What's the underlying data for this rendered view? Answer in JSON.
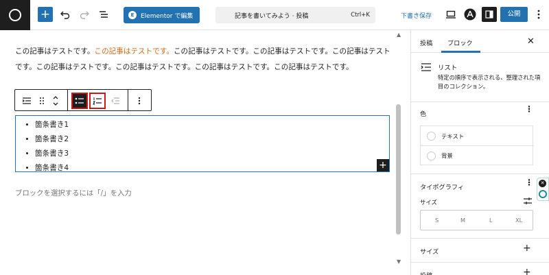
{
  "topbar": {
    "elementor_button": "Elementor で編集",
    "elementor_badge": "E",
    "document_title": "記事を書いてみよう · 投稿",
    "shortcut": "Ctrl+K",
    "save_draft": "下書き保存",
    "publish": "公開"
  },
  "editor": {
    "paragraph_before": "この記事はテストです。",
    "paragraph_highlight": "この記事はテストです。",
    "paragraph_after": "この記事はテストです。この記事はテストです。この記事はテストです。この記事はテストです。この記事はテストです。この記事はテストです。この記事はテストです。",
    "list_items": [
      "箇条書き1",
      "箇条書き2",
      "箇条書き3",
      "箇条書き4"
    ],
    "placeholder": "ブロックを選択するには「/」を入力"
  },
  "sidebar": {
    "tabs": [
      "投稿",
      "ブロック"
    ],
    "active_tab": 1,
    "block_title": "リスト",
    "block_description": "特定の順序で表示される、整理された項目のコレクション。",
    "color_section": "色",
    "color_items": [
      "テキスト",
      "背景"
    ],
    "typography_section": "タイポグラフィ",
    "size_label": "サイズ",
    "size_options": [
      "S",
      "M",
      "L",
      "XL"
    ],
    "size_section": "サイズ",
    "next_section": "投稿"
  },
  "colors": {
    "accent": "#2271b1",
    "highlight_text": "#d26812",
    "active_format_border": "#cc1818"
  }
}
